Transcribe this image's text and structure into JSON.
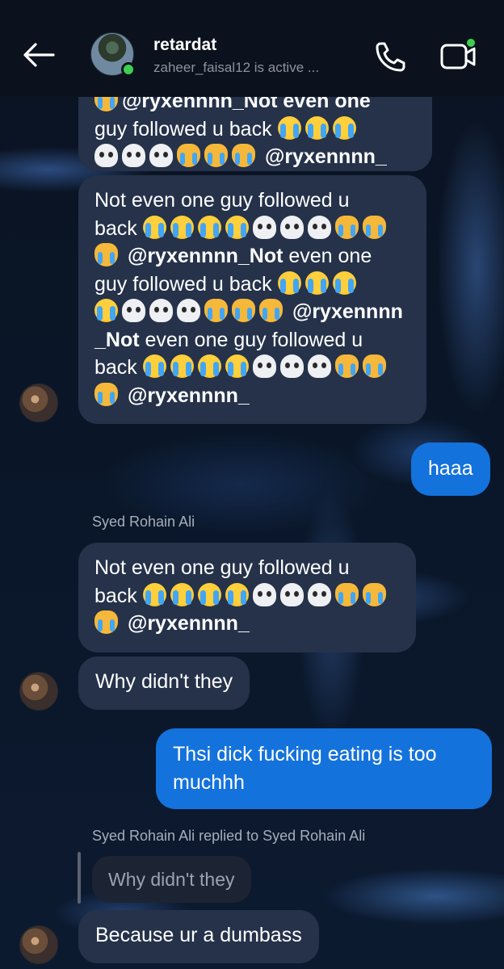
{
  "header": {
    "title": "retardat",
    "subtitle": "zaheer_faisal12 is active ..."
  },
  "messages": {
    "m1_line1": "@ryxennnn_Not even one",
    "m1_line2_text": "guy followed  u back",
    "m1_line3_mention": "@ryxennnn_",
    "m2_line1": "Not even one guy followed  u",
    "m2_line2": "back",
    "m2_line3_mention": "@ryxennnn_Not",
    "m2_line3_text": " even one",
    "m2_line4": "guy followed  u back",
    "m2_line5_mention": "@ryxennnn",
    "m2_line6_mention": "_Not",
    "m2_line6_text": " even one guy followed  u",
    "m2_line7": "back",
    "m2_line8_mention": "@ryxennnn_",
    "m3": "haaa",
    "sender1": "Syed Rohain Ali",
    "m4_line1": "Not even one guy followed  u",
    "m4_line2": "back",
    "m4_line3_mention": "@ryxennnn_",
    "m5": "Why didn't they",
    "m6_line1": "Thsi dick fucking eating is too",
    "m6_line2": "muchhh",
    "reply_label": "Syed Rohain Ali replied to Syed Rohain Ali",
    "quoted": "Why didn't they",
    "m7": "Because ur a dumbass"
  },
  "colors": {
    "incoming_bubble": "#25324a",
    "outgoing_bubble": "#1472dc",
    "active_green": "#3dd04f"
  },
  "icons": [
    "back-arrow-icon",
    "phone-icon",
    "video-call-icon",
    "loudly-crying-face-icon",
    "skull-icon",
    "crying-cat-face-icon"
  ]
}
